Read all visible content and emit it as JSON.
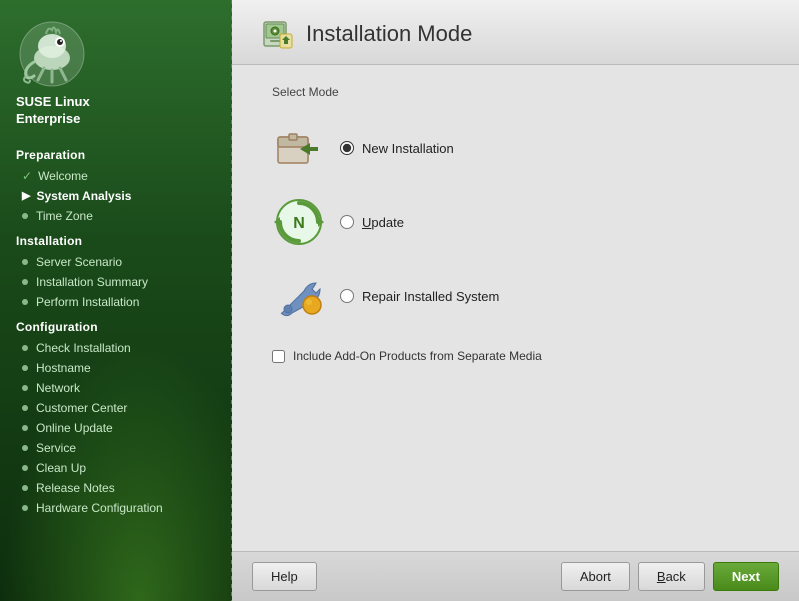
{
  "sidebar": {
    "brand": "SUSE Linux\nEnterprise",
    "sections": [
      {
        "title": "Preparation",
        "items": [
          {
            "label": "Welcome",
            "state": "done",
            "id": "welcome"
          },
          {
            "label": "System Analysis",
            "state": "active",
            "id": "system-analysis"
          },
          {
            "label": "Time Zone",
            "state": "bullet",
            "id": "time-zone"
          }
        ]
      },
      {
        "title": "Installation",
        "items": [
          {
            "label": "Server Scenario",
            "state": "bullet",
            "id": "server-scenario"
          },
          {
            "label": "Installation Summary",
            "state": "bullet",
            "id": "installation-summary"
          },
          {
            "label": "Perform Installation",
            "state": "bullet",
            "id": "perform-installation"
          }
        ]
      },
      {
        "title": "Configuration",
        "items": [
          {
            "label": "Check Installation",
            "state": "bullet",
            "id": "check-installation"
          },
          {
            "label": "Hostname",
            "state": "bullet",
            "id": "hostname"
          },
          {
            "label": "Network",
            "state": "bullet",
            "id": "network"
          },
          {
            "label": "Customer Center",
            "state": "bullet",
            "id": "customer-center"
          },
          {
            "label": "Online Update",
            "state": "bullet",
            "id": "online-update"
          },
          {
            "label": "Service",
            "state": "bullet",
            "id": "service"
          },
          {
            "label": "Clean Up",
            "state": "bullet",
            "id": "clean-up"
          },
          {
            "label": "Release Notes",
            "state": "bullet",
            "id": "release-notes"
          },
          {
            "label": "Hardware Configuration",
            "state": "bullet",
            "id": "hardware-configuration"
          }
        ]
      }
    ]
  },
  "page": {
    "title": "Installation Mode",
    "select_mode_label": "Select Mode"
  },
  "modes": [
    {
      "id": "new-install",
      "label": "New Installation",
      "selected": true
    },
    {
      "id": "update",
      "label": "Update",
      "selected": false
    },
    {
      "id": "repair",
      "label": "Repair Installed System",
      "selected": false
    }
  ],
  "addon": {
    "label": "Include Add-On Products from Separate Media",
    "checked": false
  },
  "footer": {
    "help_label": "Help",
    "abort_label": "Abort",
    "back_label": "Back",
    "next_label": "Next"
  }
}
